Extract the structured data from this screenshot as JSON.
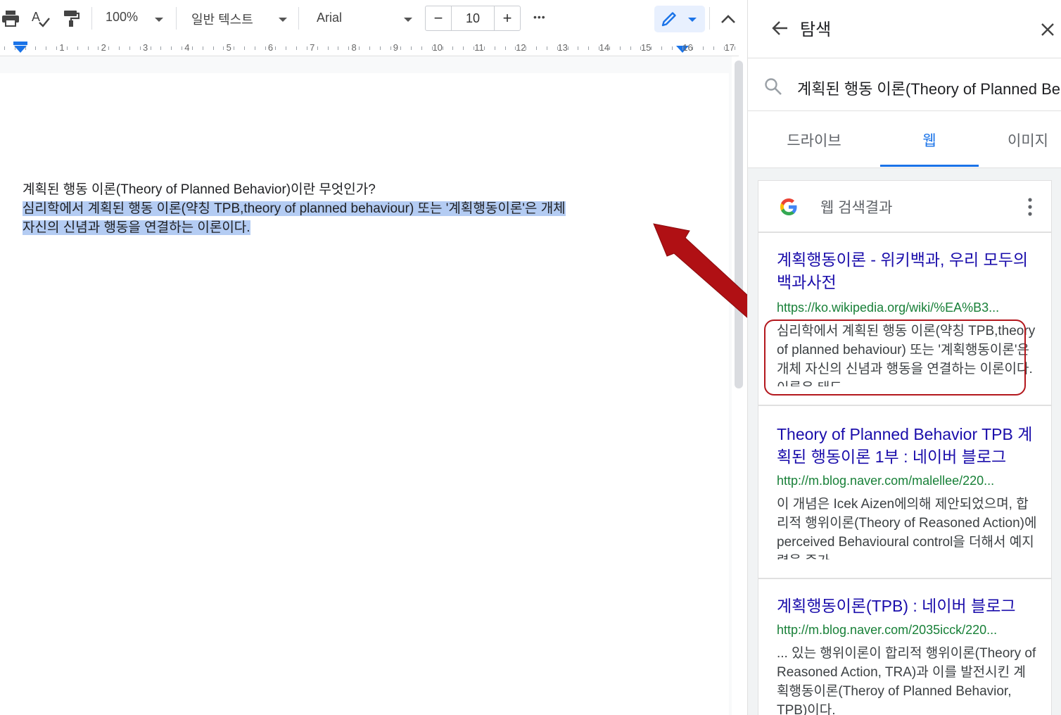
{
  "toolbar": {
    "zoom": "100%",
    "style": "일반 텍스트",
    "font": "Arial",
    "font_size": "10",
    "minus": "−",
    "plus": "+",
    "more": "•••"
  },
  "ruler": {
    "numbers": [
      "1",
      "2",
      "3",
      "4",
      "5",
      "6",
      "7",
      "8",
      "9",
      "10",
      "11",
      "12",
      "13",
      "14",
      "15",
      "16",
      "17"
    ]
  },
  "document": {
    "line1": "계획된 행동 이론(Theory of Planned Behavior)이란 무엇인가?",
    "line2": "심리학에서 계획된 행동 이론(약칭 TPB,theory of planned behaviour) 또는 '계획행동이론'은 개체",
    "line3": "자신의 신념과 행동을 연결하는 이론이다."
  },
  "panel": {
    "title": "탐색",
    "search_query": "계획된 행동 이론(Theory of Planned Behavior)",
    "tabs": [
      "드라이브",
      "웹",
      "이미지"
    ],
    "active_tab": "웹",
    "section_label": "웹 검색결과",
    "results": [
      {
        "title": "계획행동이론 - 위키백과, 우리 모두의 백과사전",
        "url": "https://ko.wikipedia.org/wiki/%EA%B3...",
        "snippet": "심리학에서 계획된 행동 이론(약칭 TPB,theory of planned behaviour) 또는 '계획행동이론'은 개체 자신의 신념과 행동을 연결하는 이론이다. 이론은 태도"
      },
      {
        "title": "Theory of Planned Behavior TPB 계획된 행동이론 1부 : 네이버 블로그",
        "url": "http://m.blog.naver.com/malellee/220...",
        "snippet": "이 개념은 Icek Aizen에의해 제안되었으며, 합리적 행위이론(Theory of Reasoned Action)에 perceived Behavioural control을 더해서 예지력을 증가"
      },
      {
        "title": "계획행동이론(TPB) : 네이버 블로그",
        "url": "http://m.blog.naver.com/2035icck/220...",
        "snippet": "... 있는 행위이론이 합리적 행위이론(Theory of Reasoned Action, TRA)과 이를 발전시킨 계획행동이론(Theroy of Planned Behavior, TPB)이다."
      }
    ]
  },
  "colors": {
    "highlight": "#b4ccf3",
    "link": "#1a0dab",
    "url": "#188038",
    "accent": "#1a73e8",
    "annotation": "#b3171d"
  },
  "icons": [
    "print-icon",
    "spellcheck-icon",
    "paint-format-icon",
    "more-icon",
    "edit-pencil-icon",
    "collapse-chevron-icon",
    "back-arrow-icon",
    "close-icon",
    "search-icon",
    "google-logo-icon",
    "kebab-menu-icon",
    "annotation-arrow-icon"
  ]
}
